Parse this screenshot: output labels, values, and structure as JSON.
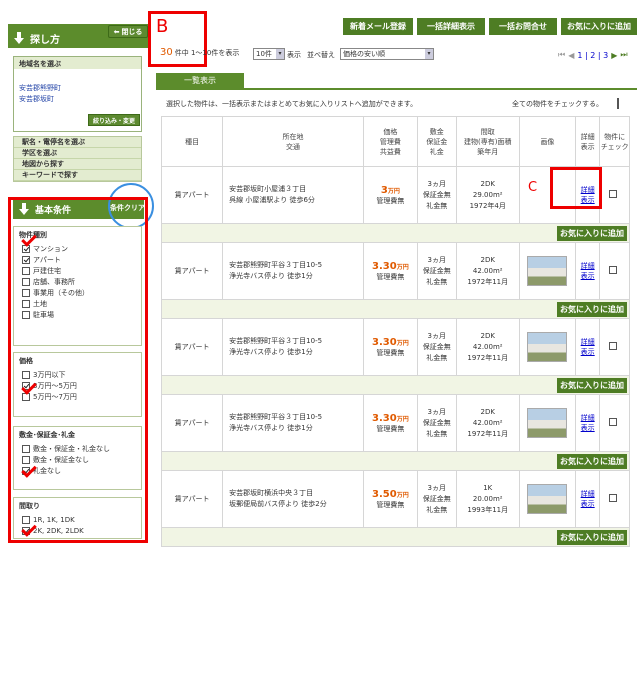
{
  "sidebar": {
    "close_label": "閉じる",
    "search_title": "探し方",
    "area_title": "地域名を選ぶ",
    "areas": [
      "安芸郡熊野町",
      "安芸郡坂町"
    ],
    "refine_button": "絞り込み・変更",
    "nav": [
      "駅名・電停名を選ぶ",
      "学区を選ぶ",
      "地図から探す",
      "キーワードで探す"
    ],
    "basic_title": "基本条件",
    "clear_label": "条件クリア",
    "annotation_a": "A",
    "type_title": "物件種別",
    "types": [
      {
        "label": "マンション",
        "checked": true
      },
      {
        "label": "アパート",
        "checked": true
      },
      {
        "label": "戸建住宅",
        "checked": false
      },
      {
        "label": "店舗、事務所",
        "checked": false
      },
      {
        "label": "事業用（その他）",
        "checked": false
      },
      {
        "label": "土地",
        "checked": false
      },
      {
        "label": "駐車場",
        "checked": false
      }
    ],
    "price_title": "価格",
    "prices": [
      {
        "label": "3万円以下",
        "checked": false
      },
      {
        "label": "3万円〜5万円",
        "checked": true
      },
      {
        "label": "5万円〜7万円",
        "checked": false
      }
    ],
    "deposit_title": "敷金･保証金･礼金",
    "deposits": [
      {
        "label": "敷金・保証金・礼金なし",
        "checked": false
      },
      {
        "label": "敷金・保証金なし",
        "checked": false
      },
      {
        "label": "礼金なし",
        "checked": true
      }
    ],
    "layout_title": "間取り",
    "layouts": [
      {
        "label": "1R, 1K, 1DK",
        "checked": false
      },
      {
        "label": "2K, 2DK, 2LDK",
        "checked": true
      }
    ]
  },
  "toolbar": {
    "buttons": [
      "新着メール登録",
      "一括詳細表示",
      "一括お問合せ",
      "お気に入りに追加"
    ],
    "annotation_b": "B",
    "count": "30",
    "count_text": "件中 1〜10件を表示",
    "per_page": "10件",
    "show": "表示",
    "sort_label": "並べ替え",
    "sort_value": "価格の安い順",
    "pager": "1 | 2 | 3",
    "list_tab": "一覧表示",
    "instruction": "選択した物件は、一括表示またはまとめてお気に入りリストへ追加ができます。",
    "check_all": "全ての物件をチェックする。"
  },
  "table": {
    "headers": {
      "type": "種目",
      "location": "所在地\n交通",
      "price": "価格\n管理費\n共益費",
      "deposit": "敷金\n保証金\n礼金",
      "layout": "間取\n建物(専有)面積\n築年月",
      "image": "画像",
      "detail": "詳細\n表示",
      "check": "物件に\nチェック"
    },
    "annotation_c": "C",
    "detail_link": "詳細\n表示",
    "fav_button": "お気に入りに追加",
    "rows": [
      {
        "type": "賃アパート",
        "address": "安芸郡坂町小屋浦３丁目",
        "access": "呉線 小屋浦駅より 徒歩6分",
        "price": "3",
        "unit": "万円",
        "mgmt": "管理費無",
        "deposit": "3ヵ月",
        "guarantee": "保証金無",
        "key": "礼金無",
        "layout": "2DK",
        "area": "29.00m²",
        "built": "1972年4月",
        "photo": false
      },
      {
        "type": "賃アパート",
        "address": "安芸郡熊野町平谷３丁目10-5",
        "access": "浄光寺バス停より 徒歩1分",
        "price": "3.30",
        "unit": "万円",
        "mgmt": "管理費無",
        "deposit": "3ヵ月",
        "guarantee": "保証金無",
        "key": "礼金無",
        "layout": "2DK",
        "area": "42.00m²",
        "built": "1972年11月",
        "photo": true
      },
      {
        "type": "賃アパート",
        "address": "安芸郡熊野町平谷３丁目10-5",
        "access": "浄光寺バス停より 徒歩1分",
        "price": "3.30",
        "unit": "万円",
        "mgmt": "管理費無",
        "deposit": "3ヵ月",
        "guarantee": "保証金無",
        "key": "礼金無",
        "layout": "2DK",
        "area": "42.00m²",
        "built": "1972年11月",
        "photo": true
      },
      {
        "type": "賃アパート",
        "address": "安芸郡熊野町平谷３丁目10-5",
        "access": "浄光寺バス停より 徒歩1分",
        "price": "3.30",
        "unit": "万円",
        "mgmt": "管理費無",
        "deposit": "3ヵ月",
        "guarantee": "保証金無",
        "key": "礼金無",
        "layout": "2DK",
        "area": "42.00m²",
        "built": "1972年11月",
        "photo": true
      },
      {
        "type": "賃アパート",
        "address": "安芸郡坂町横浜中央３丁目",
        "access": "坂郵便局前バス停より 徒歩2分",
        "price": "3.50",
        "unit": "万円",
        "mgmt": "管理費無",
        "deposit": "3ヵ月",
        "guarantee": "保証金無",
        "key": "礼金無",
        "layout": "1K",
        "area": "20.00m²",
        "built": "1993年11月",
        "photo": true
      }
    ]
  },
  "colors": {
    "brand_green": "#5c8c2c",
    "annotation_red": "#e00000",
    "annotation_blue": "#3a8fe0",
    "price_orange": "#e05a00"
  }
}
